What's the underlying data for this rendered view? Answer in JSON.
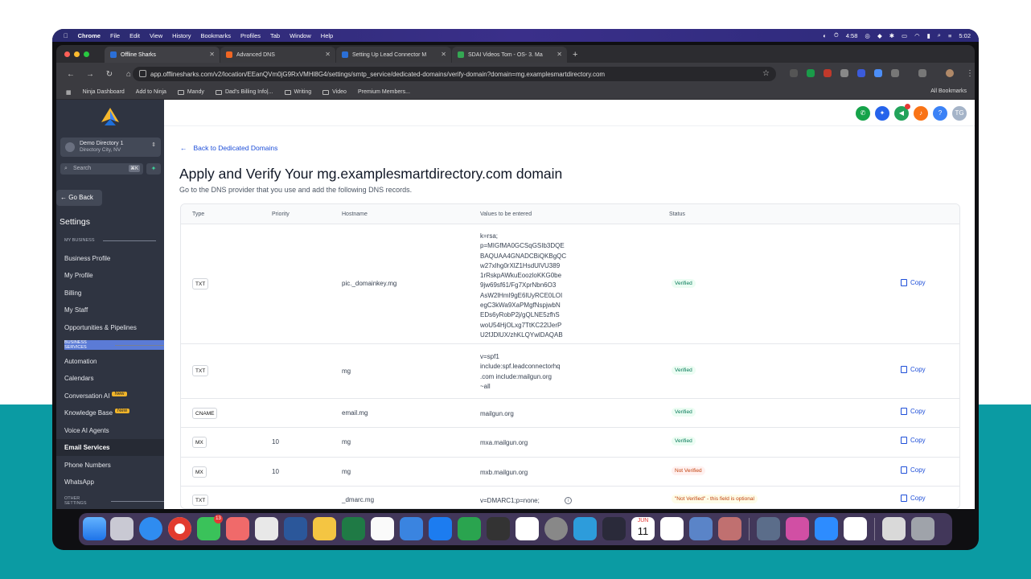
{
  "menubar": {
    "items": [
      "Chrome",
      "File",
      "Edit",
      "View",
      "History",
      "Bookmarks",
      "Profiles",
      "Tab",
      "Window",
      "Help"
    ],
    "right": [
      "4:58",
      "5:02"
    ]
  },
  "tabs": [
    {
      "label": "Offline Sharks",
      "color": "#2b6fd6"
    },
    {
      "label": "Advanced DNS",
      "color": "#f06623"
    },
    {
      "label": "Setting Up Lead Connector M",
      "color": "#2b6fd6"
    },
    {
      "label": "SDAI Videos Tom - OS- 3. Ma",
      "color": "#34a853"
    }
  ],
  "address": {
    "url": "app.offlinesharks.com/v2/location/EEanQVm0jG9RxVMHl8G4/settings/smtp_service/dedicated-domains/verify-domain?domain=mg.examplesmartdirectory.com"
  },
  "bookmarks": [
    "Ninja Dashboard",
    "Add to Ninja",
    "Mandy",
    "Dad's Billing Info|...",
    "Writing",
    "Video",
    "Premium Members..."
  ],
  "bookmarks_all": "All Bookmarks",
  "sidebar": {
    "location_name": "Demo Directory 1",
    "location_sub": "Directory City, NV",
    "search_placeholder": "Search",
    "search_kbd": "⌘K",
    "go_back": "Go Back",
    "settings_title": "Settings",
    "sections": {
      "my_business": "MY BUSINESS",
      "business_services": "BUSINESS SERVICES",
      "other_settings": "OTHER SETTINGS"
    },
    "items": [
      {
        "label": "Business Profile"
      },
      {
        "label": "My Profile"
      },
      {
        "label": "Billing"
      },
      {
        "label": "My Staff"
      },
      {
        "label": "Opportunities & Pipelines"
      },
      {
        "label": "Automation"
      },
      {
        "label": "Calendars"
      },
      {
        "label": "Conversation AI",
        "badge": "New"
      },
      {
        "label": "Knowledge Base",
        "badge": "New"
      },
      {
        "label": "Voice AI Agents"
      },
      {
        "label": "Email Services"
      },
      {
        "label": "Phone Numbers"
      },
      {
        "label": "WhatsApp"
      }
    ]
  },
  "header": {
    "avatar_initials": "TG",
    "help": "?"
  },
  "main": {
    "back_link": "Back to Dedicated Domains",
    "title": "Apply and Verify Your mg.examplesmartdirectory.com domain",
    "subtitle": "Go to the DNS provider that you use and add the following DNS records.",
    "columns": [
      "Type",
      "Priority",
      "Hostname",
      "Values to be entered",
      "Status"
    ],
    "copy_label": "Copy",
    "rows": [
      {
        "type": "TXT",
        "priority": "",
        "hostname": "pic._domainkey.mg",
        "value": "k=rsa;\np=MIGfMA0GCSqGSIb3DQE\nBAQUAA4GNADCBiQKBgQC\nw27xlhg0rXlZ1HsdUlVU389\n1rRskpAWkuEoozloKKG0be\n9jw69sf61/Fg7XprNbn6O3\nAsW2lHmI9gE6lUyRCE0LOI\negC3kWa9XaPMgfNspjwbN\nEDs6yRobP2j/gQLNE5zfhS\nwoU54HjOLxg7TtKC22lJerP\nU2fJDlUX/zhKLQYwlDAQAB",
        "status": "Verified",
        "status_kind": "ok"
      },
      {
        "type": "TXT",
        "priority": "",
        "hostname": "mg",
        "value": "v=spf1\ninclude:spf.leadconnectorhq\n.com include:mailgun.org\n~all",
        "status": "Verified",
        "status_kind": "ok"
      },
      {
        "type": "CNAME",
        "priority": "",
        "hostname": "email.mg",
        "value": "mailgun.org",
        "status": "Verified",
        "status_kind": "ok"
      },
      {
        "type": "MX",
        "priority": "10",
        "hostname": "mg",
        "value": "mxa.mailgun.org",
        "status": "Verified",
        "status_kind": "ok"
      },
      {
        "type": "MX",
        "priority": "10",
        "hostname": "mg",
        "value": "mxb.mailgun.org",
        "status": "Not Verified",
        "status_kind": "no"
      },
      {
        "type": "TXT",
        "priority": "",
        "hostname": "_dmarc.mg",
        "value": "v=DMARC1;p=none;",
        "status": "\"Not Verified\" - this field is optional",
        "status_kind": "opt"
      }
    ]
  },
  "dock": {
    "messages_badge": "13",
    "calendar_month": "JUN",
    "calendar_day": "11"
  }
}
